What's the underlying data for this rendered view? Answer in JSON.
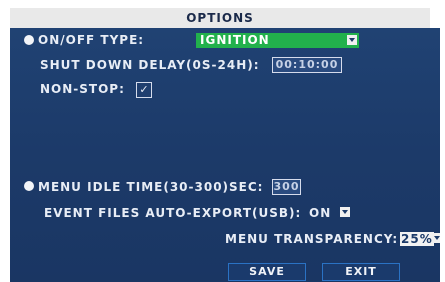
{
  "title": "OPTIONS",
  "onoff": {
    "label": "ON/OFF  TYPE:",
    "value": "IGNITION"
  },
  "shutdown": {
    "label": "SHUT  DOWN  DELAY(0S-24H):",
    "value": "00:10:00"
  },
  "nonstop": {
    "label": "NON-STOP:",
    "check_mark": "✓"
  },
  "idle": {
    "label": "MENU  IDLE  TIME(30-300)SEC:",
    "value": "300"
  },
  "export": {
    "label": "EVENT  FILES  AUTO-EXPORT(USB):",
    "value": "ON"
  },
  "transparency": {
    "label": "MENU  TRANSPARENCY:",
    "value": "25%"
  },
  "buttons": {
    "save": "SAVE",
    "exit": "EXIT"
  },
  "colors": {
    "panel_bg": "#1d3c6b",
    "dropdown_green": "#22b14c",
    "title_bg": "#e9e9e9"
  }
}
